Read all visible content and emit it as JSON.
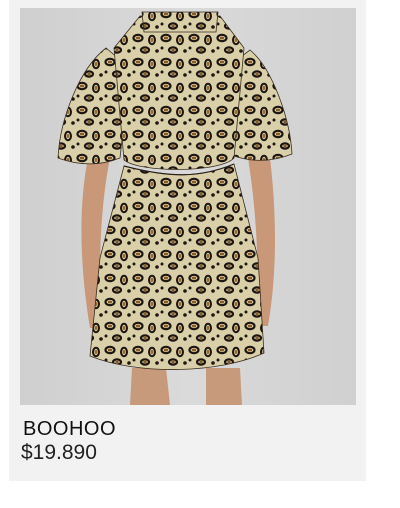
{
  "product": {
    "image_alt": "leopard-print-dress-photo",
    "brand": "BOOHOO",
    "price": "$19.890"
  },
  "colors": {
    "card_bg": "#f2f2f2",
    "photo_bg": "#d5d5d5",
    "fabric_base": "#d9cfa8",
    "spot_dark": "#1c1510",
    "spot_brown": "#8a5a22"
  }
}
